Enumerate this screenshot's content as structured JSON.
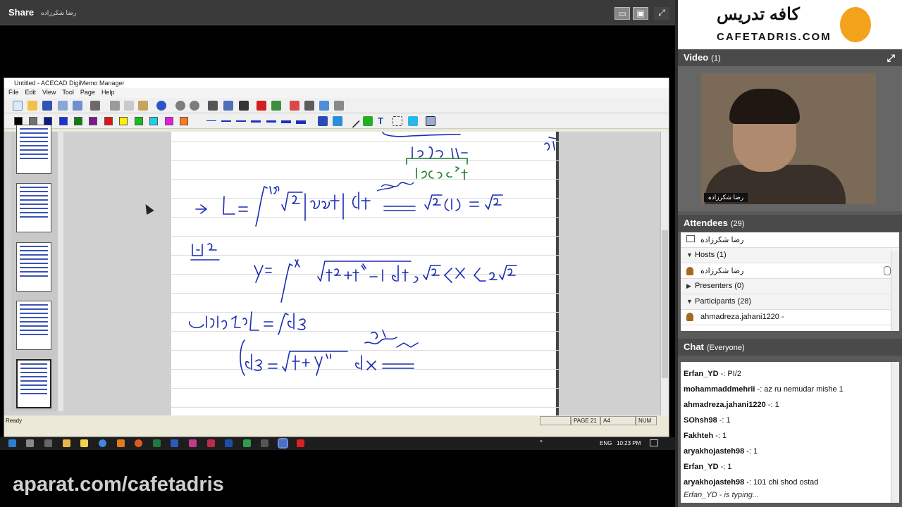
{
  "share": {
    "title": "Share",
    "presenter": "رضا شکرزاده"
  },
  "app": {
    "title": "Untitled - ACECAD DigiMemo Manager",
    "menu": [
      "File",
      "Edit",
      "View",
      "Tool",
      "Page",
      "Help"
    ],
    "colors": [
      "#000000",
      "#707070",
      "#101a80",
      "#1a2fdf",
      "#0f7d0f",
      "#7a1a8a",
      "#e01515",
      "#ffee00",
      "#16c016",
      "#18d0e8",
      "#e61ae6",
      "#ff7a1a"
    ],
    "status": {
      "ready": "Ready",
      "page": "PAGE 21",
      "size": "A4",
      "num": "NUM"
    }
  },
  "taskbar": {
    "lang": "ENG",
    "time": "10:23 PM"
  },
  "watermark": "aparat.com/cafetadris",
  "logo": {
    "fa": "كافه تدريس",
    "en": "CAFETADRIS.COM"
  },
  "video": {
    "title": "Video",
    "count": "(1)",
    "name": "رضا شکرزاده"
  },
  "attendees": {
    "title": "Attendees",
    "count": "(29)",
    "me": "رضا شکرزاده",
    "hosts_label": "Hosts (1)",
    "host": "رضا شکرزاده",
    "presenters_label": "Presenters (0)",
    "participants_label": "Participants (28)",
    "participant": "ahmadreza.jahani1220 -"
  },
  "chat": {
    "title": "Chat",
    "scope": "(Everyone)",
    "messages": [
      {
        "user": "Erfan_YD",
        "text": "-: PI/2"
      },
      {
        "user": "mohammaddmehrii",
        "text": "-: az ru nemudar mishe 1"
      },
      {
        "user": "ahmadreza.jahani1220",
        "text": "-: 1"
      },
      {
        "user": "SOhsh98",
        "text": "-: 1"
      },
      {
        "user": "Fakhteh",
        "text": "-: 1"
      },
      {
        "user": "aryakhojasteh98",
        "text": "-: 1"
      },
      {
        "user": "Erfan_YD",
        "text": "-: 1"
      },
      {
        "user": "aryakhojasteh98",
        "text": "-: 101 chi shod ostad"
      }
    ],
    "typing": "Erfan_YD - is typing..."
  }
}
